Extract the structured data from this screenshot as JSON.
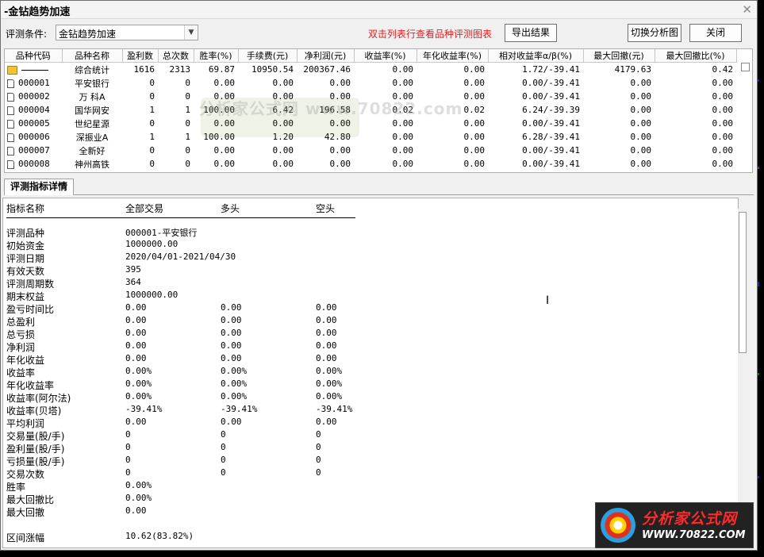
{
  "window": {
    "title": "-金钻趋势加速"
  },
  "toolbar": {
    "cond_label": "评测条件:",
    "cond_value": "金钻趋势加速",
    "hint": "双击列表行查看品种评测图表",
    "export_label": "导出结果",
    "switch_label": "切换分析图",
    "close_label": "关闭"
  },
  "table": {
    "columns": [
      "品种代码",
      "品种名称",
      "盈利数",
      "总次数",
      "胜率(%)",
      "手续费(元)",
      "净利润(元)",
      "收益率(%)",
      "年化收益率(%)",
      "相对收益率α/β(%)",
      "最大回撤(元)",
      "最大回撤比(%)"
    ],
    "rows": [
      {
        "code": "",
        "name": "综合统计",
        "win": "1616",
        "total": "2313",
        "rate": "69.87",
        "fee": "10950.54",
        "profit": "200367.46",
        "ret": "0.00",
        "annual": "0.00",
        "rel": "1.72/-39.41",
        "dd": "4179.63",
        "ddr": "0.42"
      },
      {
        "code": "000001",
        "name": "平安银行",
        "win": "0",
        "total": "0",
        "rate": "0.00",
        "fee": "0.00",
        "profit": "0.00",
        "ret": "0.00",
        "annual": "0.00",
        "rel": "0.00/-39.41",
        "dd": "0.00",
        "ddr": "0.00"
      },
      {
        "code": "000002",
        "name": "万 科A",
        "win": "0",
        "total": "0",
        "rate": "0.00",
        "fee": "0.00",
        "profit": "0.00",
        "ret": "0.00",
        "annual": "0.00",
        "rel": "0.00/-39.41",
        "dd": "0.00",
        "ddr": "0.00"
      },
      {
        "code": "000004",
        "name": "国华网安",
        "win": "1",
        "total": "1",
        "rate": "100.00",
        "fee": "6.42",
        "profit": "196.58",
        "ret": "0.02",
        "annual": "0.02",
        "rel": "6.24/-39.39",
        "dd": "0.00",
        "ddr": "0.00"
      },
      {
        "code": "000005",
        "name": "世纪星源",
        "win": "0",
        "total": "0",
        "rate": "0.00",
        "fee": "0.00",
        "profit": "0.00",
        "ret": "0.00",
        "annual": "0.00",
        "rel": "0.00/-39.41",
        "dd": "0.00",
        "ddr": "0.00"
      },
      {
        "code": "000006",
        "name": "深振业A",
        "win": "1",
        "total": "1",
        "rate": "100.00",
        "fee": "1.20",
        "profit": "42.80",
        "ret": "0.00",
        "annual": "0.00",
        "rel": "6.28/-39.41",
        "dd": "0.00",
        "ddr": "0.00"
      },
      {
        "code": "000007",
        "name": "全新好",
        "win": "0",
        "total": "0",
        "rate": "0.00",
        "fee": "0.00",
        "profit": "0.00",
        "ret": "0.00",
        "annual": "0.00",
        "rel": "0.00/-39.41",
        "dd": "0.00",
        "ddr": "0.00"
      },
      {
        "code": "000008",
        "name": "神州高铁",
        "win": "0",
        "total": "0",
        "rate": "0.00",
        "fee": "0.00",
        "profit": "0.00",
        "ret": "0.00",
        "annual": "0.00",
        "rel": "0.00/-39.41",
        "dd": "0.00",
        "ddr": "0.00"
      }
    ]
  },
  "watermark": "分析家公式网 www.70822.com",
  "details": {
    "tab_label": "评测指标详情",
    "headers": [
      "指标名称",
      "全部交易",
      "多头",
      "空头"
    ],
    "rows": [
      [
        "评测品种",
        "000001-平安银行",
        "",
        ""
      ],
      [
        "初始资金",
        "1000000.00",
        "",
        ""
      ],
      [
        "评测日期",
        "2020/04/01-2021/04/30",
        "",
        ""
      ],
      [
        "有效天数",
        "395",
        "",
        ""
      ],
      [
        "评测周期数",
        "364",
        "",
        ""
      ],
      [
        "期末权益",
        "1000000.00",
        "",
        ""
      ],
      [
        "盈亏时间比",
        "0.00",
        "0.00",
        "0.00"
      ],
      [
        "总盈利",
        "0.00",
        "0.00",
        "0.00"
      ],
      [
        "总亏损",
        "0.00",
        "0.00",
        "0.00"
      ],
      [
        "净利润",
        "0.00",
        "0.00",
        "0.00"
      ],
      [
        "年化收益",
        "0.00",
        "0.00",
        "0.00"
      ],
      [
        "收益率",
        "0.00%",
        "0.00%",
        "0.00%"
      ],
      [
        "年化收益率",
        "0.00%",
        "0.00%",
        "0.00%"
      ],
      [
        "收益率(阿尔法)",
        "0.00%",
        "0.00%",
        "0.00%"
      ],
      [
        "收益率(贝塔)",
        "-39.41%",
        "-39.41%",
        "-39.41%"
      ],
      [
        "平均利润",
        "0.00",
        "0.00",
        "0.00"
      ],
      [
        "交易量(股/手)",
        "0",
        "0",
        "0"
      ],
      [
        "盈利量(股/手)",
        "0",
        "0",
        "0"
      ],
      [
        "亏损量(股/手)",
        "0",
        "0",
        "0"
      ],
      [
        "交易次数",
        "0",
        "0",
        "0"
      ],
      [
        "胜率",
        "0.00%",
        "",
        ""
      ],
      [
        "最大回撤比",
        "0.00%",
        "",
        ""
      ],
      [
        "最大回撤",
        "0.00",
        "",
        ""
      ]
    ],
    "extra": [
      "区间涨幅",
      "10.62(83.82%)"
    ]
  },
  "logo": {
    "cn": "分析家公式网",
    "url": "WWW.70822.COM"
  }
}
